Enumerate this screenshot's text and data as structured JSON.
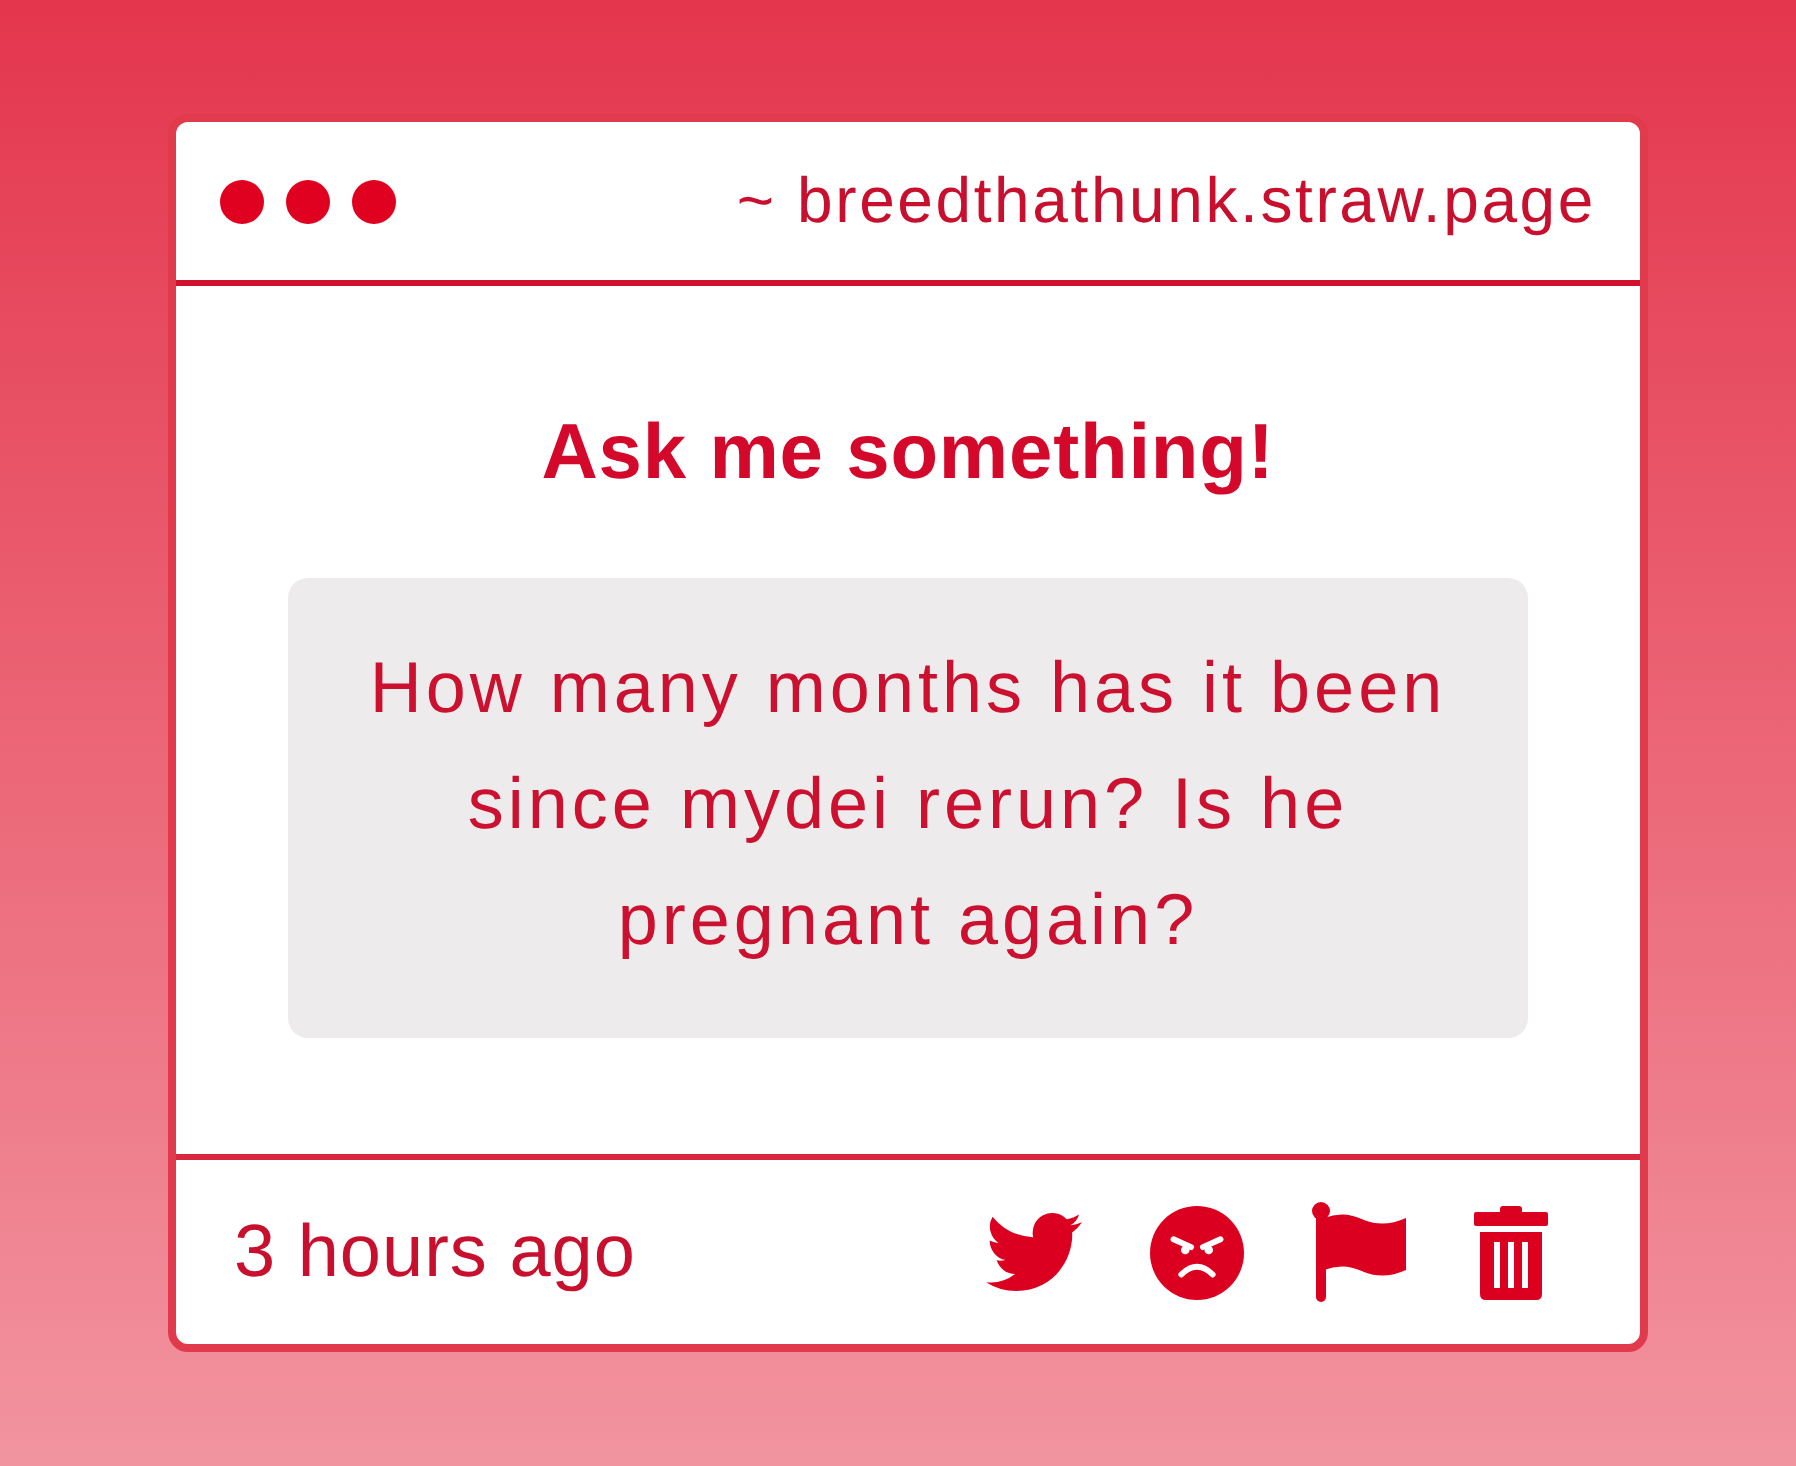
{
  "window": {
    "address": "~ breedthathunk.straw.page"
  },
  "heading": "Ask me something!",
  "question": "How many months has it been since mydei rerun? Is he pregnant again?",
  "footer": {
    "timestamp": "3 hours ago"
  }
}
